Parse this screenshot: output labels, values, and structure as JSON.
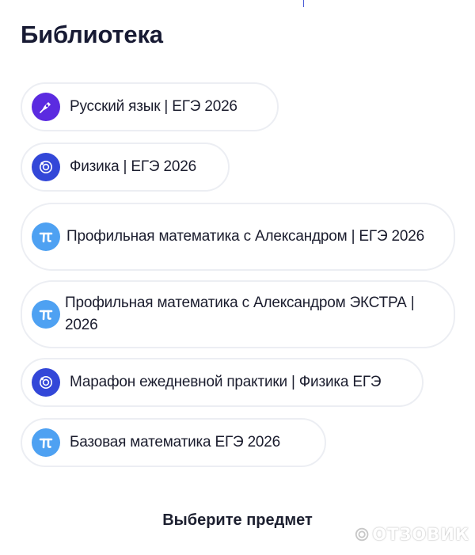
{
  "library": {
    "title": "Библиотека",
    "courses": [
      {
        "label": "Русский язык | ЕГЭ 2026",
        "icon": "feather-pen-icon",
        "icon_color": "#5b2be0"
      },
      {
        "label": "Физика | ЕГЭ 2026",
        "icon": "atom-icon",
        "icon_color": "#3347d8"
      },
      {
        "label": "Профильная математика с Александром | ЕГЭ 2026",
        "icon": "pi-icon",
        "icon_color": "#4ea1f2"
      },
      {
        "label": "Профильная математика с Александром ЭКСТРА | 2026",
        "icon": "pi-icon",
        "icon_color": "#4ea1f2"
      },
      {
        "label": "Марафон ежедневной практики | Физика ЕГЭ",
        "icon": "atom-icon",
        "icon_color": "#3347d8"
      },
      {
        "label": "Базовая математика ЕГЭ 2026",
        "icon": "pi-icon",
        "icon_color": "#4ea1f2"
      }
    ],
    "footer": "Выберите предмет"
  },
  "watermark": {
    "text": "ОТЗОВИК"
  },
  "colors": {
    "title": "#171a33",
    "card_border": "#eceef3",
    "accent_purple": "#5b2be0",
    "accent_blue": "#3347d8",
    "accent_light_blue": "#4ea1f2"
  }
}
